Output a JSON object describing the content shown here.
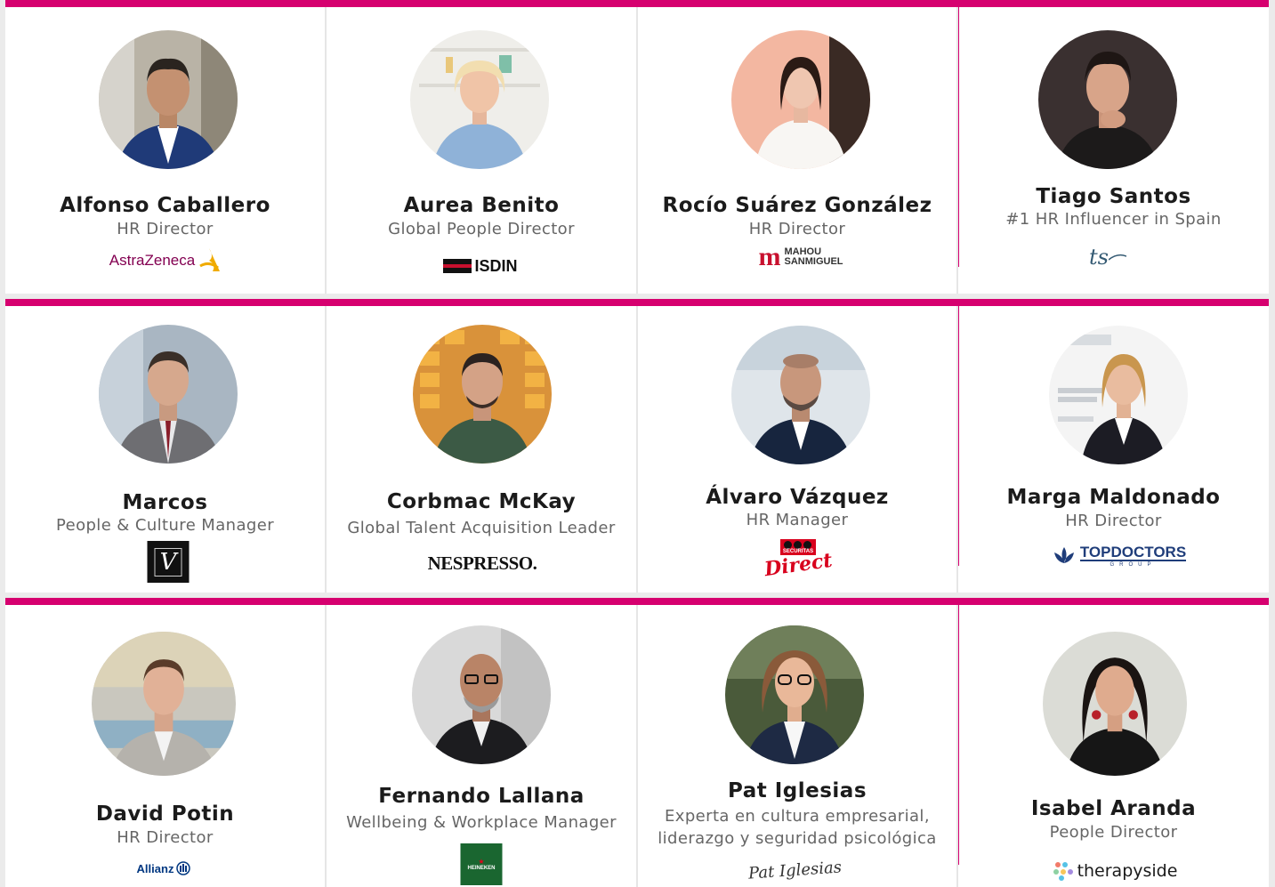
{
  "colors": {
    "accent": "#d6006f",
    "text": "#1b1b1b",
    "muted": "#666666"
  },
  "rows": [
    {
      "cards": [
        {
          "name": "Alfonso Caballero",
          "role": "HR Director",
          "logo": "AstraZeneca"
        },
        {
          "name": "Aurea Benito",
          "role": "Global People Director",
          "logo": "ISDIN"
        },
        {
          "name": "Rocío Suárez González",
          "role": "HR Director",
          "logo_line1": "MAHOU",
          "logo_line2": "SANMIGUEL"
        },
        {
          "name": "Tiago Santos",
          "role": "#1 HR Influencer in Spain",
          "logo": "ts"
        }
      ]
    },
    {
      "cards": [
        {
          "name": "Marcos",
          "role": "People & Culture Manager",
          "logo": "V"
        },
        {
          "name": "Corbmac McKay",
          "role": "Global Talent Acquisition Leader",
          "logo": "NESPRESSO."
        },
        {
          "name": "Álvaro Vázquez",
          "role": "HR Manager",
          "logo_line1": "SECURITAS",
          "logo_line2": "Direct"
        },
        {
          "name": "Marga Maldonado",
          "role": "HR Director",
          "logo_line1": "TOPDOCTORS",
          "logo_line2": "GROUP"
        }
      ]
    },
    {
      "cards": [
        {
          "name": "David Potin",
          "role": "HR Director",
          "logo": "Allianz"
        },
        {
          "name": "Fernando Lallana",
          "role": "Wellbeing & Workplace Manager",
          "logo": "HEINEKEN"
        },
        {
          "name": "Pat Iglesias",
          "role_line1": "Experta en cultura empresarial,",
          "role_line2": "liderazgo y seguridad psicológica",
          "logo": "Pat Iglesias"
        },
        {
          "name": "Isabel Aranda",
          "role": "People Director",
          "logo": "therapyside"
        }
      ]
    }
  ]
}
